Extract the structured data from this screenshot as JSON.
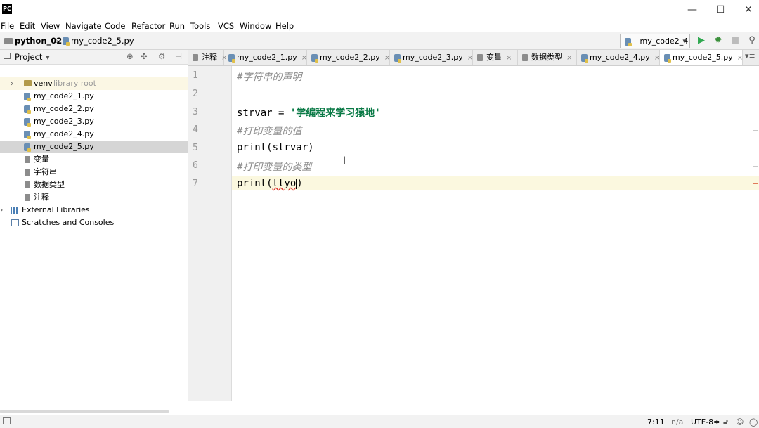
{
  "app": {
    "logo_text": "PC"
  },
  "window": {
    "minimize": "—",
    "maximize": "☐",
    "close": "✕"
  },
  "menu": [
    "File",
    "Edit",
    "View",
    "Navigate",
    "Code",
    "Refactor",
    "Run",
    "Tools",
    "VCS",
    "Window",
    "Help"
  ],
  "breadcrumb": {
    "project": "python_02",
    "file": "my_code2_5.py",
    "sep": "›"
  },
  "run_config": {
    "label": "my_code2_4",
    "arrow": "▾"
  },
  "project_panel": {
    "title": "Project",
    "arrow": "▾"
  },
  "tree": {
    "venv": {
      "label": "venv",
      "note": "library root"
    },
    "files": [
      "my_code2_1.py",
      "my_code2_2.py",
      "my_code2_3.py",
      "my_code2_4.py",
      "my_code2_5.py"
    ],
    "other_files": [
      "变量",
      "字符串",
      "数据类型",
      "注释"
    ],
    "external": "External Libraries",
    "scratches": "Scratches and Consoles"
  },
  "tabs": [
    "注释",
    "my_code2_1.py",
    "my_code2_2.py",
    "my_code2_3.py",
    "变量",
    "数据类型",
    "my_code2_4.py",
    "my_code2_5.py"
  ],
  "tab_close": "×",
  "editor": {
    "line_numbers": [
      "1",
      "2",
      "3",
      "4",
      "5",
      "6",
      "7"
    ],
    "line1": "#字符串的声明",
    "line3_prefix": "strvar = ",
    "line3_string": "'学编程来学习猿地'",
    "line4": "#打印变量的值",
    "line5": "print(strvar)",
    "line6": "#打印变量的类型",
    "line7_prefix": "print(",
    "line7_error": "ttyo",
    "line7_suffix": ")"
  },
  "status": {
    "position": "7:11",
    "na": "n/a",
    "encoding": "UTF-8",
    "enc_arrow": "≑"
  },
  "colors": {
    "run_green": "#2fa84f",
    "debug_green": "#3a8f3a",
    "string_green": "#0a7a46"
  }
}
